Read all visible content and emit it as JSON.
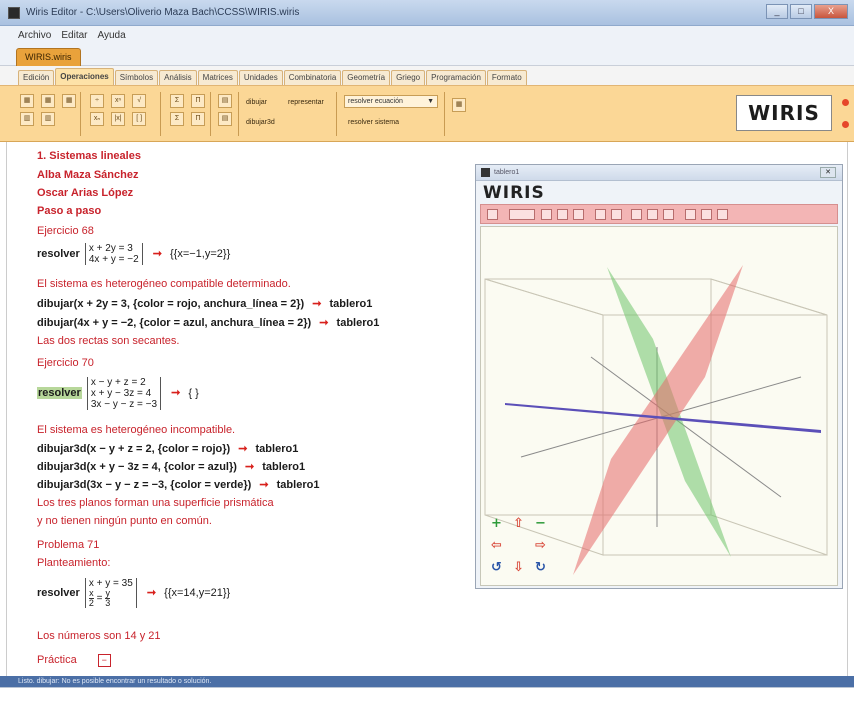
{
  "window": {
    "title": "Wiris Editor - C:\\Users\\Oliverio Maza Bach\\CCSS\\WIRIS.wiris",
    "close_label": "X"
  },
  "menu": {
    "items": [
      "Archivo",
      "Editar",
      "Ayuda"
    ]
  },
  "file_tab": {
    "label": "WIRIS.wiris"
  },
  "tabs": [
    "Edición",
    "Operaciones",
    "Símbolos",
    "Análisis",
    "Matrices",
    "Unidades",
    "Combinatoria",
    "Geometría",
    "Griego",
    "Programación",
    "Formato"
  ],
  "toolbar": {
    "draw": "dibujar",
    "represent": "representar",
    "draw3d": "dibujar3d",
    "solve_equation": "resolver ecuación",
    "solve_system": "resolver sistema",
    "brand": "WIRIS"
  },
  "doc": {
    "heading": "1. Sistemas lineales",
    "author1": "Alba Maza Sánchez",
    "author2": "Oscar Arias López",
    "step": "Paso a paso",
    "ex68": "Ejercicio 68",
    "solve": "resolver",
    "sys68": [
      "x + 2y = 3",
      "4x + y = −2"
    ],
    "res68": "{{x=−1,y=2}}",
    "t68": "El sistema es heterogéneo compatible determinado.",
    "draw1": "dibujar(x + 2y = 3, {color = rojo, anchura_línea = 2})",
    "draw2": "dibujar(4x + y = −2, {color = azul, anchura_línea = 2})",
    "board": "tablero1",
    "secant": "Las dos rectas son secantes.",
    "ex70": "Ejercicio 70",
    "sys70": [
      "x − y + z = 2",
      "x + y − 3z = 4",
      "3x − y − z = −3"
    ],
    "res70": "{ }",
    "t70": "El sistema es heterogéneo incompatible.",
    "d3a": "dibujar3d(x − y + z = 2, {color = rojo})",
    "d3b": "dibujar3d(x + y − 3z = 4, {color = azul})",
    "d3c": "dibujar3d(3x − y − z = −3, {color = verde})",
    "prism1": "Los tres planos forman una superficie prismática",
    "prism2": "y no tienen ningún punto en común.",
    "p71": "Problema 71",
    "plan": "Planteamiento:",
    "sys71a": "x + y = 35",
    "frac_num1": "x",
    "frac_den1": "2",
    "frac_num2": "y",
    "frac_den2": "3",
    "res71": "{{x=14,y=21}}",
    "nums": "Los números son 14 y 21",
    "practice": "Práctica"
  },
  "graph": {
    "title": "tablero1",
    "brand": "WIRIS"
  },
  "status": {
    "text": "Listo. dibujar: No es posible encontrar un resultado o solución."
  }
}
